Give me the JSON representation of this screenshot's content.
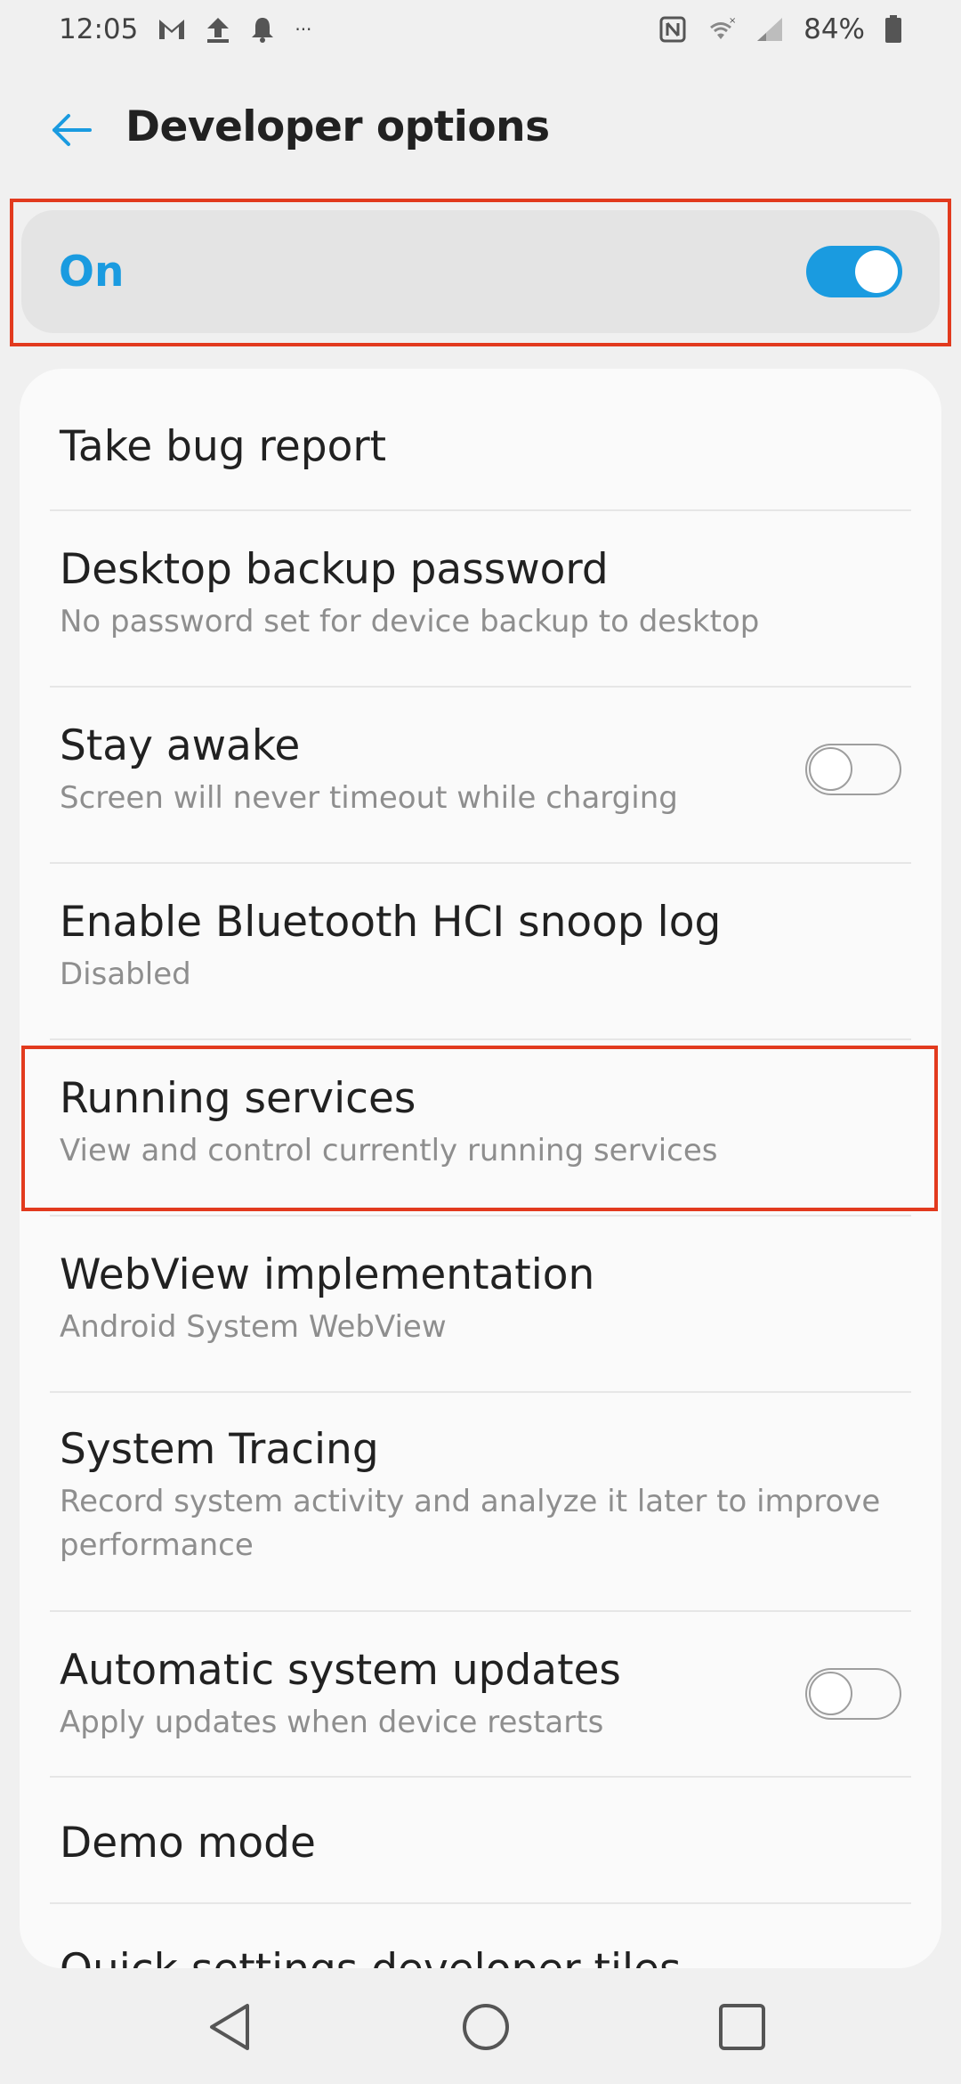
{
  "status_bar": {
    "time": "12:05",
    "left_icons": [
      "gmail-icon",
      "upload-icon",
      "notification-bell-icon",
      "more-notifications-icon"
    ],
    "more_text": "···",
    "right_icons": [
      "nfc-icon",
      "wifi-icon",
      "signal-icon",
      "battery-icon"
    ],
    "battery": "84%"
  },
  "header": {
    "title": "Developer options",
    "back_icon": "arrow-back-icon"
  },
  "master_switch": {
    "label": "On",
    "state": true,
    "accent": "#1a9be0"
  },
  "settings": [
    {
      "title": "Take bug report",
      "subtitle": "",
      "toggle": null
    },
    {
      "title": "Desktop backup password",
      "subtitle": "No password set for device backup to desktop",
      "toggle": null
    },
    {
      "title": "Stay awake",
      "subtitle": "Screen will never timeout while charging",
      "toggle": false
    },
    {
      "title": "Enable Bluetooth HCI snoop log",
      "subtitle": "Disabled",
      "toggle": null
    },
    {
      "title": "Running services",
      "subtitle": "View and control currently running services",
      "toggle": null
    },
    {
      "title": "WebView implementation",
      "subtitle": "Android System WebView",
      "toggle": null
    },
    {
      "title": "System Tracing",
      "subtitle": "Record system activity and analyze it later to improve performance",
      "toggle": null
    },
    {
      "title": "Automatic system updates",
      "subtitle": "Apply updates when device restarts",
      "toggle": false
    },
    {
      "title": "Demo mode",
      "subtitle": "",
      "toggle": null
    },
    {
      "title": "Quick settings developer tiles",
      "subtitle": "",
      "toggle": null
    }
  ],
  "highlight_color": "#e23a1e",
  "nav_bar": {
    "buttons": [
      "back-triangle-icon",
      "home-circle-icon",
      "recents-square-icon"
    ]
  }
}
